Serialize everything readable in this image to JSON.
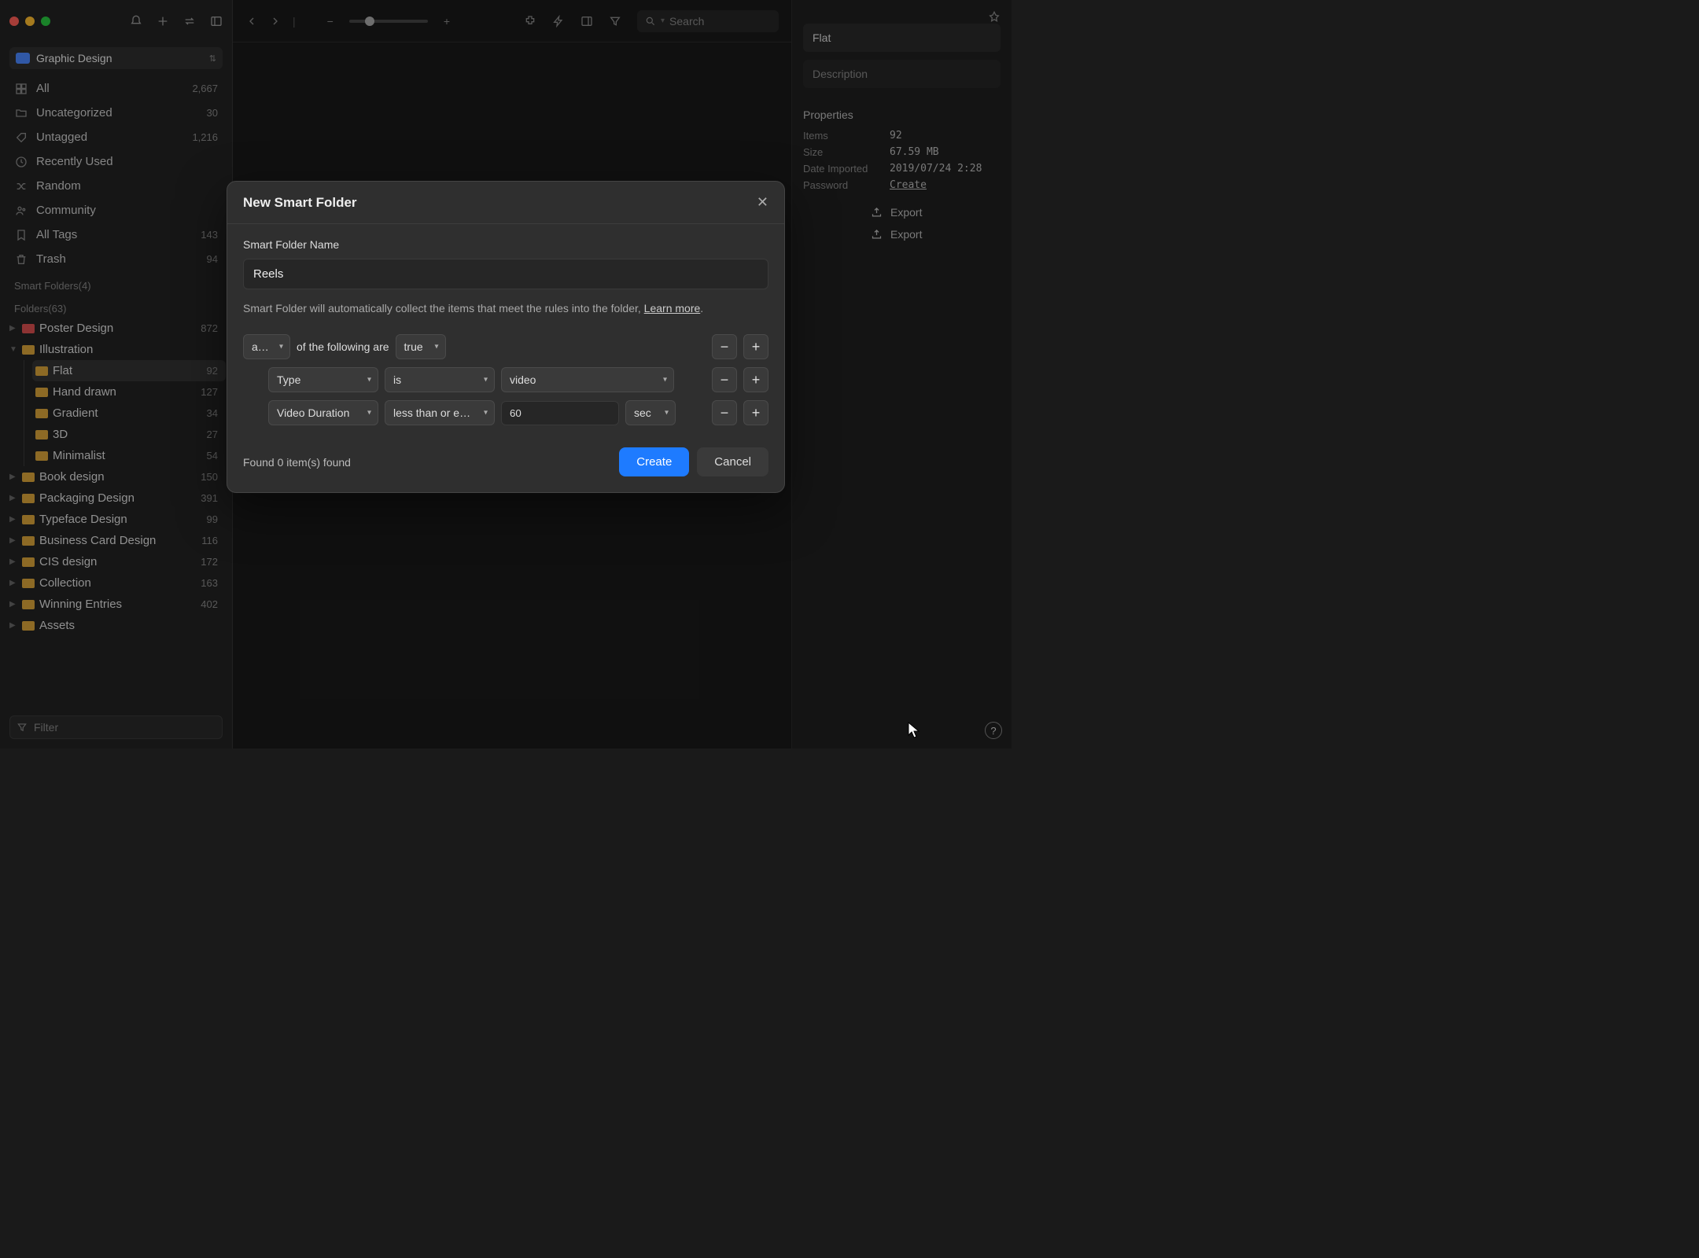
{
  "library": {
    "name": "Graphic Design"
  },
  "search": {
    "placeholder": "Search"
  },
  "sidebar": {
    "items": [
      {
        "icon": "grid",
        "label": "All",
        "count": "2,667"
      },
      {
        "icon": "folder-open",
        "label": "Uncategorized",
        "count": "30"
      },
      {
        "icon": "tag-off",
        "label": "Untagged",
        "count": "1,216"
      },
      {
        "icon": "clock",
        "label": "Recently Used",
        "count": ""
      },
      {
        "icon": "shuffle",
        "label": "Random",
        "count": ""
      },
      {
        "icon": "users",
        "label": "Community",
        "count": ""
      },
      {
        "icon": "bookmark",
        "label": "All Tags",
        "count": "143"
      },
      {
        "icon": "trash",
        "label": "Trash",
        "count": "94"
      }
    ],
    "smart_folders_heading": "Smart Folders(4)",
    "folders_heading": "Folders(63)",
    "folders": [
      {
        "color": "red",
        "label": "Poster Design",
        "count": "872"
      },
      {
        "color": "yellow",
        "label": "Illustration",
        "count": "",
        "expanded": true,
        "children": [
          {
            "label": "Flat",
            "count": "92",
            "selected": true
          },
          {
            "label": "Hand drawn",
            "count": "127"
          },
          {
            "label": "Gradient",
            "count": "34"
          },
          {
            "label": "3D",
            "count": "27"
          },
          {
            "label": "Minimalist",
            "count": "54"
          }
        ]
      },
      {
        "color": "yellow",
        "label": "Book design",
        "count": "150"
      },
      {
        "color": "yellow",
        "label": "Packaging Design",
        "count": "391"
      },
      {
        "color": "yellow",
        "label": "Typeface Design",
        "count": "99"
      },
      {
        "color": "yellow",
        "label": "Business Card Design",
        "count": "116"
      },
      {
        "color": "yellow",
        "label": "CIS design",
        "count": "172"
      },
      {
        "color": "yellow",
        "label": "Collection",
        "count": "163"
      },
      {
        "color": "yellow",
        "label": "Winning Entries",
        "count": "402"
      },
      {
        "color": "yellow",
        "label": "Assets",
        "count": ""
      }
    ],
    "filter_placeholder": "Filter"
  },
  "right_panel": {
    "title": "Flat",
    "desc_placeholder": "Description",
    "properties_heading": "Properties",
    "rows": {
      "items_k": "Items",
      "items_v": "92",
      "size_k": "Size",
      "size_v": "67.59 MB",
      "date_k": "Date Imported",
      "date_v": "2019/07/24 2:28",
      "pass_k": "Password",
      "pass_v": "Create"
    },
    "export": "Export"
  },
  "modal": {
    "title": "New Smart Folder",
    "name_label": "Smart Folder Name",
    "name_value": "Reels",
    "help_prefix": "Smart Folder will automatically collect the items that meet the rules into the folder, ",
    "help_link": "Learn more",
    "help_dot": ".",
    "match": {
      "mode": "any",
      "mid": "of the following are",
      "truth": "true"
    },
    "rules": [
      {
        "field": "Type",
        "op": "is",
        "value": "video"
      },
      {
        "field": "Video Duration",
        "op": "less than or equal",
        "num": "60",
        "unit": "sec"
      }
    ],
    "found": "Found 0 item(s) found",
    "create": "Create",
    "cancel": "Cancel"
  }
}
